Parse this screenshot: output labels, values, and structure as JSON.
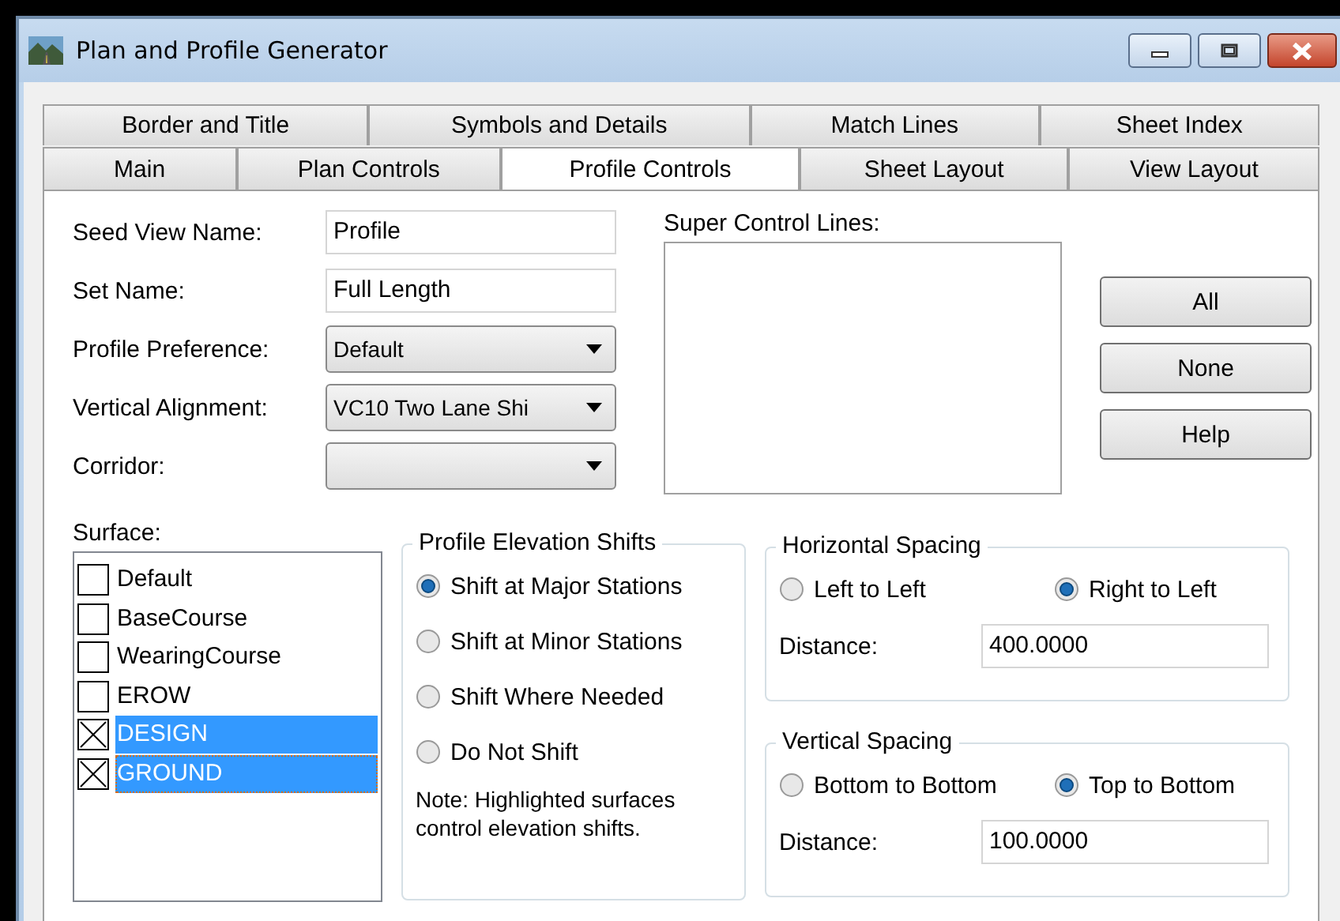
{
  "window": {
    "title": "Plan and Profile Generator"
  },
  "tab_rows": [
    [
      {
        "label": "Border and Title",
        "selected": false
      },
      {
        "label": "Symbols and Details",
        "selected": false
      },
      {
        "label": "Match Lines",
        "selected": false
      },
      {
        "label": "Sheet Index",
        "selected": false
      }
    ],
    [
      {
        "label": "Main",
        "selected": false
      },
      {
        "label": "Plan Controls",
        "selected": false
      },
      {
        "label": "Profile Controls",
        "selected": true
      },
      {
        "label": "Sheet Layout",
        "selected": false
      },
      {
        "label": "View Layout",
        "selected": false
      }
    ]
  ],
  "fields": [
    {
      "kind": "text",
      "label": "Seed View Name:",
      "value": "Profile"
    },
    {
      "kind": "text",
      "label": "Set Name:",
      "value": "Full Length"
    },
    {
      "kind": "dropdown",
      "label": "Profile Preference:",
      "value": "Default"
    },
    {
      "kind": "dropdown",
      "label": "Vertical Alignment:",
      "value": "VC10 Two Lane Shi"
    },
    {
      "kind": "dropdown",
      "label": "Corridor:"
    }
  ],
  "super_control_lines": {
    "label": "Super Control Lines:"
  },
  "buttons": [
    "All",
    "None",
    "Help"
  ],
  "surface": {
    "label": "Surface:",
    "items": [
      {
        "name": "Default",
        "checked": false,
        "selected": false,
        "focused": false
      },
      {
        "name": "BaseCourse",
        "checked": false,
        "selected": false,
        "focused": false
      },
      {
        "name": "WearingCourse",
        "checked": false,
        "selected": false,
        "focused": false
      },
      {
        "name": "EROW",
        "checked": false,
        "selected": false,
        "focused": false
      },
      {
        "name": "DESIGN",
        "checked": true,
        "selected": true,
        "focused": false
      },
      {
        "name": "GROUND",
        "checked": true,
        "selected": true,
        "focused": true
      }
    ]
  },
  "profile_elevation_shifts": {
    "title": "Profile Elevation Shifts",
    "options": [
      {
        "label": "Shift at Major Stations",
        "selected": true
      },
      {
        "label": "Shift at Minor Stations",
        "selected": false
      },
      {
        "label": "Shift Where Needed",
        "selected": false
      },
      {
        "label": "Do Not Shift",
        "selected": false
      }
    ],
    "note": "Note: Highlighted surfaces control elevation shifts."
  },
  "horizontal_spacing": {
    "title": "Horizontal Spacing",
    "options": [
      {
        "label": "Left to Left",
        "selected": false
      },
      {
        "label": "Right to Left",
        "selected": true
      }
    ],
    "distance_label": "Distance:",
    "distance": "400.0000"
  },
  "vertical_spacing": {
    "title": "Vertical Spacing",
    "options": [
      {
        "label": "Bottom to Bottom",
        "selected": false
      },
      {
        "label": "Top to Bottom",
        "selected": true
      }
    ],
    "distance_label": "Distance:",
    "distance": "100.0000"
  }
}
